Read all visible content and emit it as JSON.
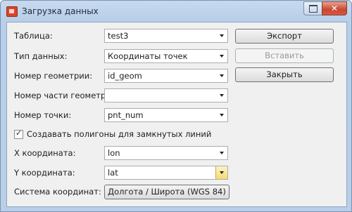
{
  "window": {
    "title": "Загрузка данных"
  },
  "form": {
    "table_label": "Таблица:",
    "table_value": "test3",
    "datatype_label": "Тип данных:",
    "datatype_value": "Координаты точек",
    "geom_label": "Номер геометрии:",
    "geom_value": "id_geom",
    "part_label": "Номер части геометрии:",
    "part_value": "",
    "point_label": "Номер точки:",
    "point_value": "pnt_num",
    "polygon_checkbox_label": "Создавать полигоны для замкнутых линий",
    "polygon_checkbox_checked": true,
    "x_label": "X координата:",
    "x_value": "lon",
    "y_label": "Y координата:",
    "y_value": "lat",
    "crs_label": "Система координат:",
    "crs_button_label": "Долгота / Широта (WGS 84)"
  },
  "buttons": {
    "export_label": "Экспорт",
    "insert_label": "Вставить",
    "close_label": "Закрыть"
  }
}
